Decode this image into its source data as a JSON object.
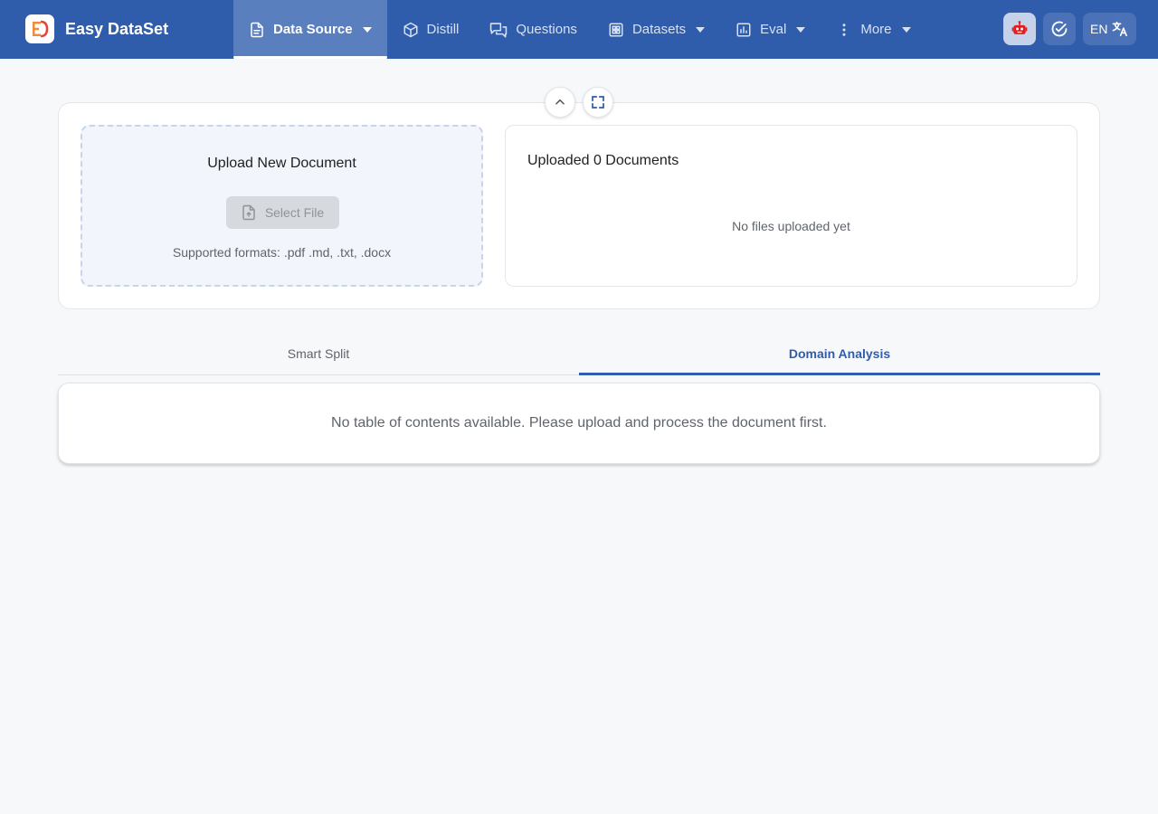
{
  "app": {
    "name": "Easy DataSet"
  },
  "nav": {
    "items": [
      {
        "label": "Data Source",
        "icon": "document-icon",
        "dropdown": true,
        "active": true
      },
      {
        "label": "Distill",
        "icon": "cube-icon",
        "dropdown": false,
        "active": false
      },
      {
        "label": "Questions",
        "icon": "chat-icon",
        "dropdown": false,
        "active": false
      },
      {
        "label": "Datasets",
        "icon": "grid-icon",
        "dropdown": true,
        "active": false
      },
      {
        "label": "Eval",
        "icon": "bar-chart-icon",
        "dropdown": true,
        "active": false
      },
      {
        "label": "More",
        "icon": "more-vertical-icon",
        "dropdown": true,
        "active": false
      }
    ]
  },
  "top_actions": {
    "robot_icon": "robot-icon",
    "task_icon": "check-circle-icon",
    "language": "EN",
    "language_icon": "translate-icon"
  },
  "upload": {
    "title": "Upload New Document",
    "button_label": "Select File",
    "formats": "Supported formats: .pdf .md, .txt, .docx"
  },
  "uploaded": {
    "title": "Uploaded 0 Documents",
    "empty": "No files uploaded yet"
  },
  "tabs": [
    {
      "label": "Smart Split",
      "active": false
    },
    {
      "label": "Domain Analysis",
      "active": true
    }
  ],
  "content": {
    "empty_message": "No table of contents available. Please upload and process the document first."
  },
  "colors": {
    "nav_bg": "#2f5dab",
    "accent": "#2f5dab",
    "logo_orange": "#f08a3c"
  }
}
